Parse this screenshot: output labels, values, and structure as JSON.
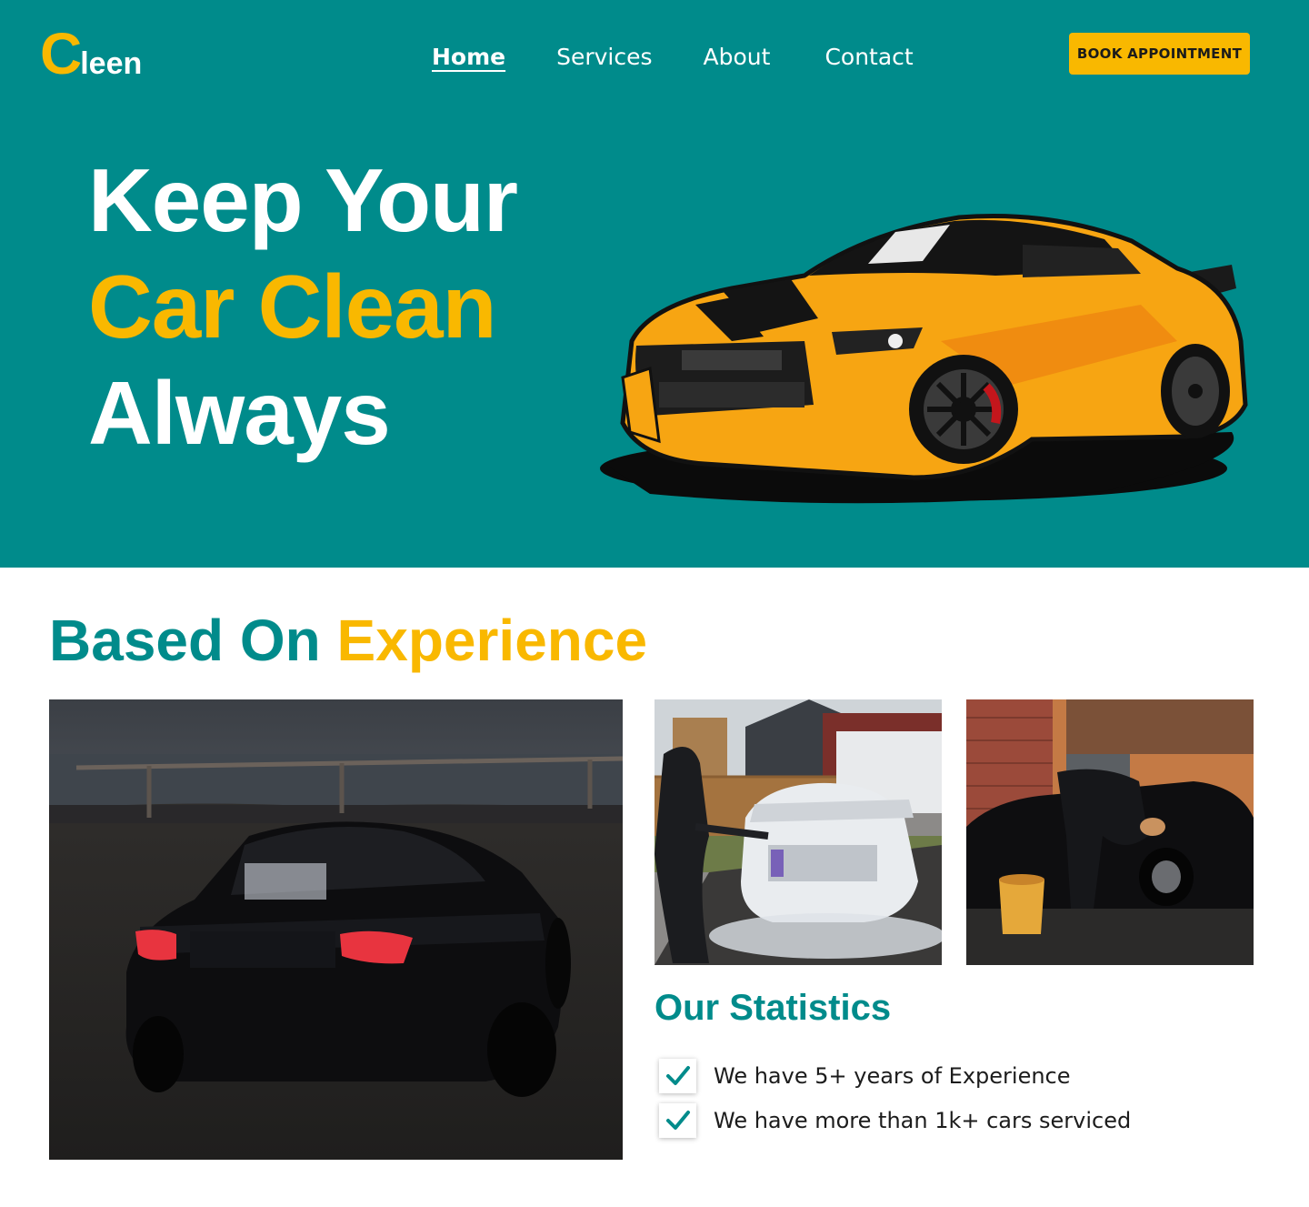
{
  "brand": {
    "logo_initial": "C",
    "logo_rest": "leen",
    "accent_color": "#f9b800",
    "primary_color": "#008b8b"
  },
  "nav": {
    "items": [
      {
        "label": "Home",
        "active": true
      },
      {
        "label": "Services",
        "active": false
      },
      {
        "label": "About",
        "active": false
      },
      {
        "label": "Contact",
        "active": false
      }
    ],
    "cta_label": "BOOK APPOINTMENT"
  },
  "hero": {
    "line1": "Keep Your",
    "line2": "Car Clean",
    "line3": "Always",
    "image_icon": "yellow-sports-car-illustration"
  },
  "experience": {
    "title_part1": "Based On",
    "title_part2": "Experience",
    "photos": [
      "black-coupe-rear-photo",
      "car-foam-washing-photo",
      "hand-washing-car-photo"
    ]
  },
  "statistics": {
    "title": "Our Statistics",
    "items": [
      {
        "text": "We have 5+ years of Experience",
        "icon": "check-icon"
      },
      {
        "text": "We have more than 1k+ cars serviced",
        "icon": "check-icon"
      }
    ]
  }
}
